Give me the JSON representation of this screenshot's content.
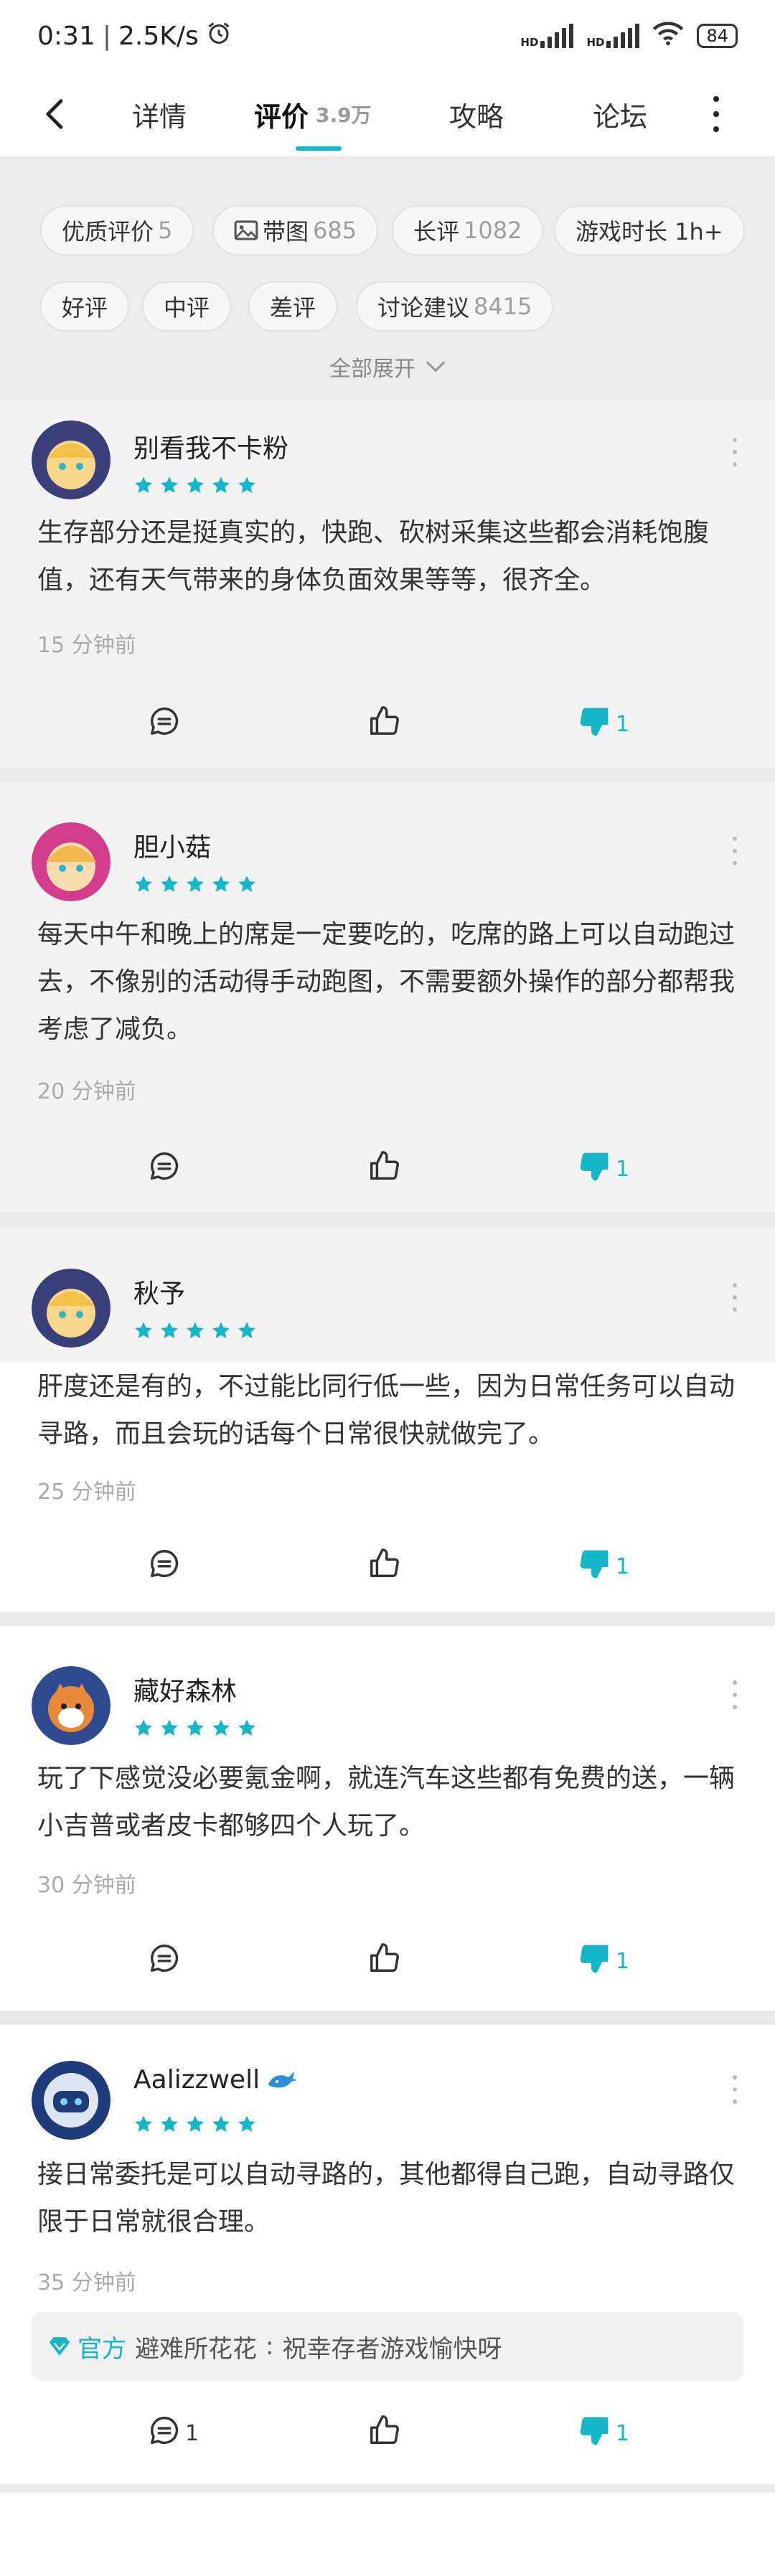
{
  "status_bar": {
    "time": "0:31",
    "speed": "2.5K/s",
    "hd1": "HD",
    "hd2": "HD",
    "battery": "84"
  },
  "nav": {
    "tabs": [
      {
        "label": "详情",
        "count": ""
      },
      {
        "label": "评价",
        "count": "3.9万"
      },
      {
        "label": "攻略",
        "count": ""
      },
      {
        "label": "论坛",
        "count": ""
      }
    ],
    "accent_color": "#14b6c8"
  },
  "filters": {
    "chips": [
      {
        "label": "优质评价",
        "count": "5"
      },
      {
        "label": "带图",
        "count": "685",
        "icon": "image-icon"
      },
      {
        "label": "长评",
        "count": "1082"
      },
      {
        "label": "游戏时长 1h+",
        "count": ""
      },
      {
        "label": "好评",
        "count": ""
      },
      {
        "label": "中评",
        "count": ""
      },
      {
        "label": "差评",
        "count": ""
      },
      {
        "label": "讨论建议",
        "count": "8415"
      }
    ],
    "expand_label": "全部展开"
  },
  "reviews": [
    {
      "user": "别看我不卡粉",
      "rating": 5,
      "text": "生存部分还是挺真实的，快跑、砍树采集这些都会消耗饱腹值，还有天气带来的身体负面效果等等，很齐全。",
      "time": "15 分钟前",
      "comments": "",
      "likes": "",
      "dislikes": "1"
    },
    {
      "user": "胆小菇",
      "rating": 5,
      "text": "每天中午和晚上的席是一定要吃的，吃席的路上可以自动跑过去，不像别的活动得手动跑图，不需要额外操作的部分都帮我考虑了减负。",
      "time": "20 分钟前",
      "comments": "",
      "likes": "",
      "dislikes": "1"
    },
    {
      "user": "秋予",
      "rating": 5,
      "text": "肝度还是有的，不过能比同行低一些，因为日常任务可以自动寻路，而且会玩的话每个日常很快就做完了。",
      "time": "25 分钟前",
      "comments": "",
      "likes": "",
      "dislikes": "1"
    },
    {
      "user": "藏好森林",
      "rating": 5,
      "text": "玩了下感觉没必要氪金啊，就连汽车这些都有免费的送，一辆小吉普或者皮卡都够四个人玩了。",
      "time": "30 分钟前",
      "comments": "",
      "likes": "",
      "dislikes": "1"
    },
    {
      "user": "Aalizzwell",
      "rating": 5,
      "text": "接日常委托是可以自动寻路的，其他都得自己跑，自动寻路仅限于日常就很合理。",
      "time": "35 分钟前",
      "comments": "1",
      "likes": "",
      "dislikes": "1",
      "reply": {
        "tag": "官方",
        "author": "避难所花花",
        "text": "祝幸存者游戏愉快呀"
      }
    }
  ]
}
